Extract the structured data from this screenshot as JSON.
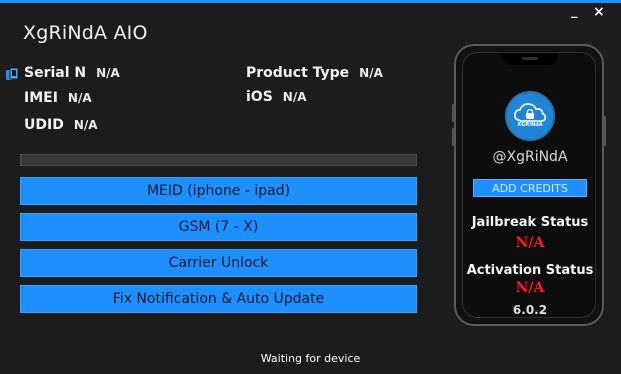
{
  "window": {
    "title": "XgRiNdA AIO",
    "minimize_glyph": "_",
    "close_glyph": "×"
  },
  "device": {
    "serial": {
      "label": "Serial N",
      "value": "N/A"
    },
    "product_type": {
      "label": "Product Type",
      "value": "N/A"
    },
    "imei": {
      "label": "IMEI",
      "value": "N/A"
    },
    "ios": {
      "label": "iOS",
      "value": "N/A"
    },
    "udid": {
      "label": "UDID",
      "value": "N/A"
    }
  },
  "progress": {
    "value": 0
  },
  "actions": [
    {
      "label": "MEID (iphone - ipad)"
    },
    {
      "label": "GSM (7 - X)"
    },
    {
      "label": "Carrier Unlock"
    },
    {
      "label": "Fix Notification & Auto Update"
    }
  ],
  "phone": {
    "logo_text": "XGRiNdA",
    "handle": "@XgRiNdA",
    "add_credits": "ADD CREDITS",
    "jailbreak": {
      "title": "Jailbreak Status",
      "value": "N/A"
    },
    "activation": {
      "title": "Activation Status",
      "value": "N/A"
    },
    "version": "6.0.2"
  },
  "status": "Waiting for device",
  "colors": {
    "accent": "#1e8fff",
    "background": "#1c1c1c",
    "status_red": "#ff1a1a"
  }
}
